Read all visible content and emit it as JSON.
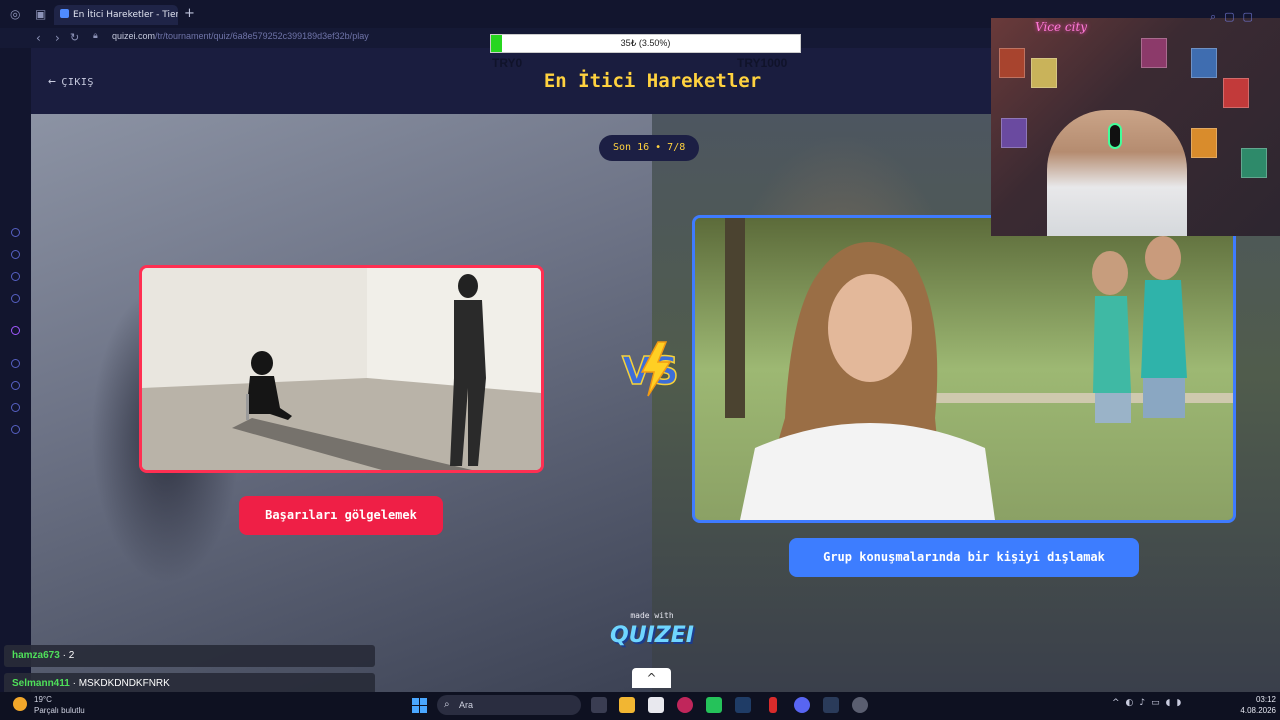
{
  "browser": {
    "tab_title": "En İtici Hareketler - Tier List",
    "url_host": "quizei.com",
    "url_path": "/tr/tournament/quiz/6a8e579252c399189d3ef32b/play"
  },
  "donation": {
    "label": "35₺ (3.50%)",
    "progress_percent": 3.5,
    "min_label": "TRY0",
    "max_label": "TRY1000"
  },
  "quiz": {
    "exit_label": "ÇIKIŞ",
    "title": "En İtici Hareketler",
    "round": "Son 16 • 7/8",
    "left_option": "Başarıları gölgelemek",
    "right_option": "Grup konuşmalarında bir kişiyi dışlamak",
    "vs_label": "VS",
    "made_with": "made with",
    "brand": "QUIZEI",
    "scroll_up": "^"
  },
  "chat": [
    {
      "user": "hamza673",
      "sep": " · ",
      "message": "2"
    },
    {
      "user": "Selmann411",
      "sep": " · ",
      "message": "MSKDKDNDKFNRK"
    }
  ],
  "webcam": {
    "neon_sign": "Vice city"
  },
  "taskbar": {
    "temperature": "19°C",
    "weather": "Parçalı bulutlu",
    "search_placeholder": "Ara",
    "time": "03:12",
    "date": "4.08.2026"
  },
  "colors": {
    "accent_title": "#ffd23f",
    "left_card": "#ef1f46",
    "right_card": "#3d7dff",
    "chat_user": "#4fe05a"
  }
}
